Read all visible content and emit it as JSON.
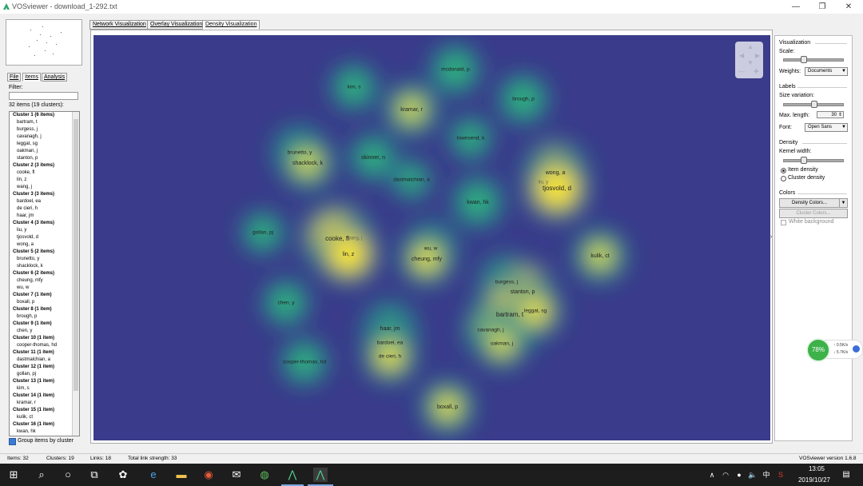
{
  "window": {
    "title": "VOSviewer - download_1-292.txt",
    "minimize": "—",
    "maximize": "❐",
    "close": "✕"
  },
  "left_panel": {
    "tabs": [
      "File",
      "Items",
      "Analysis"
    ],
    "filter_label": "Filter:",
    "filter_value": "",
    "items_summary": "32 items (19 clusters):",
    "list": [
      {
        "h": "Cluster 1 (6 items)"
      },
      {
        "i": "bartram, t"
      },
      {
        "i": "burgess, j"
      },
      {
        "i": "cavanagh, j"
      },
      {
        "i": "leggat, sg"
      },
      {
        "i": "oakman, j"
      },
      {
        "i": "stanton, p"
      },
      {
        "h": "Cluster 2 (3 items)"
      },
      {
        "i": "cooke, fl"
      },
      {
        "i": "lin, z"
      },
      {
        "i": "wang, j"
      },
      {
        "h": "Cluster 3 (3 items)"
      },
      {
        "i": "bardoel, ea"
      },
      {
        "i": "de cieri, h"
      },
      {
        "i": "haar, jm"
      },
      {
        "h": "Cluster 4 (3 items)"
      },
      {
        "i": "liu, y"
      },
      {
        "i": "tjosvold, d"
      },
      {
        "i": "wong, a"
      },
      {
        "h": "Cluster 5 (2 items)"
      },
      {
        "i": "brunetto, y"
      },
      {
        "i": "shacklock, k"
      },
      {
        "h": "Cluster 6 (2 items)"
      },
      {
        "i": "cheung, mfy"
      },
      {
        "i": "wu, w"
      },
      {
        "h": "Cluster 7 (1 item)"
      },
      {
        "i": "boxall, p"
      },
      {
        "h": "Cluster 8 (1 item)"
      },
      {
        "i": "brough, p"
      },
      {
        "h": "Cluster 9 (1 item)"
      },
      {
        "i": "chen, y"
      },
      {
        "h": "Cluster 10 (1 item)"
      },
      {
        "i": "cooper-thomas, hd"
      },
      {
        "h": "Cluster 11 (1 item)"
      },
      {
        "i": "dastmalchian, a"
      },
      {
        "h": "Cluster 12 (1 item)"
      },
      {
        "i": "gollan, pj"
      },
      {
        "h": "Cluster 13 (1 item)"
      },
      {
        "i": "kim, s"
      },
      {
        "h": "Cluster 14 (1 item)"
      },
      {
        "i": "kramar, r"
      },
      {
        "h": "Cluster 15 (1 item)"
      },
      {
        "i": "kulik, ct"
      },
      {
        "h": "Cluster 16 (1 item)"
      },
      {
        "i": "kwan, hk"
      }
    ],
    "group_checkbox_label": "Group items by cluster"
  },
  "viz_tabs": [
    "Network Visualization",
    "Overlay Visualization",
    "Density Visualization"
  ],
  "density_map": {
    "colors": {
      "background": "#3a3b8a",
      "low": "#26828e",
      "mid": "#35b779",
      "high": "#fde725"
    },
    "labels": [
      {
        "text": "mcdonald, p"
      },
      {
        "text": "kim, s"
      },
      {
        "text": "kramar, r"
      },
      {
        "text": "brough, p"
      },
      {
        "text": "townsend, k"
      },
      {
        "text": "brunetto, y"
      },
      {
        "text": "shacklock, k"
      },
      {
        "text": "skinner, n"
      },
      {
        "text": "dastmalchian, a"
      },
      {
        "text": "wong, a"
      },
      {
        "text": "liu, y"
      },
      {
        "text": "tjosvold, d"
      },
      {
        "text": "kwan, hk"
      },
      {
        "text": "gollan, pj"
      },
      {
        "text": "cooke, fl"
      },
      {
        "text": "wang, j"
      },
      {
        "text": "lin, z"
      },
      {
        "text": "wu, w"
      },
      {
        "text": "cheung, mfy"
      },
      {
        "text": "kulik, ct"
      },
      {
        "text": "burgess, j"
      },
      {
        "text": "stanton, p"
      },
      {
        "text": "chen, y"
      },
      {
        "text": "bartram, t"
      },
      {
        "text": "leggat, sg"
      },
      {
        "text": "haar, jm"
      },
      {
        "text": "cavanagh, j"
      },
      {
        "text": "bardoel, ea"
      },
      {
        "text": "oakman, j"
      },
      {
        "text": "de cieri, h"
      },
      {
        "text": "cooper-thomas, hd"
      },
      {
        "text": "boxall, p"
      }
    ]
  },
  "right_panel": {
    "visualization_header": "Visualization",
    "scale_label": "Scale:",
    "weights_label": "Weights:",
    "weights_value": "Documents",
    "labels_header": "Labels",
    "size_variation_label": "Size variation:",
    "max_length_label": "Max. length:",
    "max_length_value": "30",
    "font_label": "Font:",
    "font_value": "Open Sans",
    "density_header": "Density",
    "kernel_width_label": "Kernel width:",
    "item_density_label": "Item density",
    "cluster_density_label": "Cluster density",
    "colors_header": "Colors",
    "density_colors_button": "Density Colors...",
    "cluster_colors_button": "Cluster Colors...",
    "white_background_label": "White background"
  },
  "status_bar": {
    "items": "Items:  32",
    "clusters": "Clusters:  19",
    "links": "Links:  18",
    "total_link_strength": "Total link strength:  33",
    "version": "VOSviewer version 1.6.8"
  },
  "net_widget": {
    "percent": "78%",
    "up": "0.5K/s",
    "down": "5.7K/s"
  },
  "taskbar": {
    "time": "13:05",
    "date": "2019/10/27",
    "ime": "中"
  }
}
